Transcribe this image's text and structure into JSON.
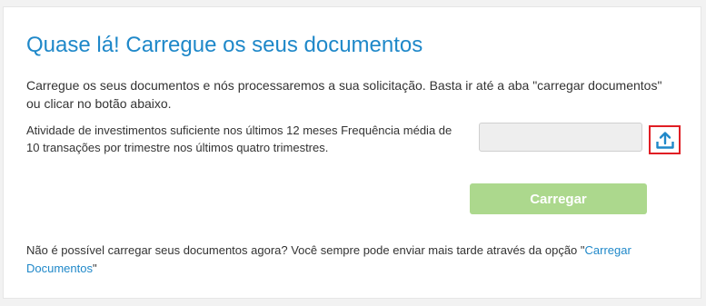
{
  "card": {
    "title": "Quase lá! Carregue os seus documentos",
    "intro": "Carregue os seus documentos e nós processaremos a sua solicitação. Basta ir até a aba \"carregar documentos\" ou clicar no botão abaixo.",
    "requirement_text": "Atividade de investimentos suficiente nos últimos 12 meses Frequência média de 10 transações por trimestre nos últimos quatro trimestres.",
    "file_input": {
      "value": "",
      "placeholder": ""
    },
    "upload_icon": "upload-icon",
    "submit_label": "Carregar",
    "footer": {
      "text_before": "Não é possível carregar seus documentos agora? Você sempre pode enviar mais tarde através da opção ",
      "quote_open": "\"",
      "link_label": "Carregar Documentos",
      "quote_close": "\""
    }
  },
  "colors": {
    "title": "#1f88c9",
    "link": "#1f88c9",
    "submit_button": "#acd88d",
    "upload_highlight_border": "#e01e24",
    "upload_icon": "#1f88c9",
    "input_background": "#eeeeee"
  }
}
